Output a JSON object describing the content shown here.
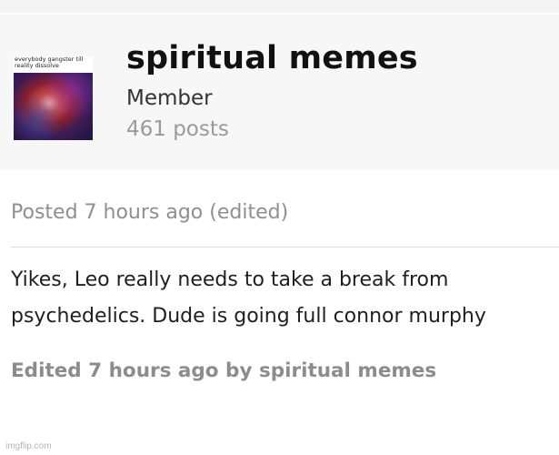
{
  "profile": {
    "avatar_caption": "everybody gangster till reality dissolve",
    "username": "spiritual memes",
    "role": "Member",
    "post_count": "461 posts"
  },
  "post": {
    "posted_label": "Posted 7 hours ago (edited)",
    "body_line_1": "Yikes, Leo really needs to take a break from",
    "body_line_2": "psychedelics. Dude is going full connor murphy",
    "edited_note": "Edited 7 hours ago by spiritual memes"
  },
  "watermark": "imgflip.com"
}
